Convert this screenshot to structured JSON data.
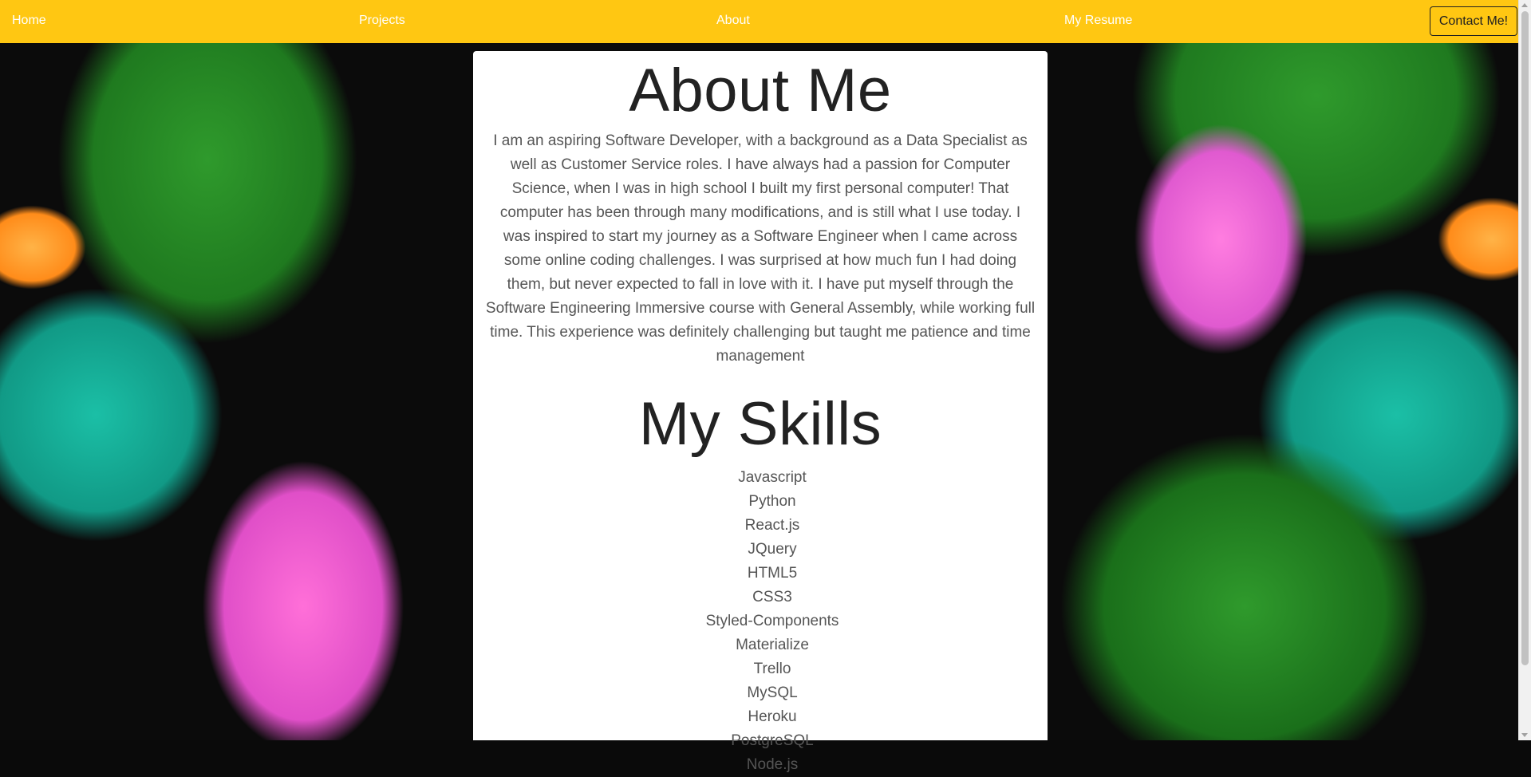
{
  "nav": {
    "home": "Home",
    "projects": "Projects",
    "about": "About",
    "resume": "My Resume",
    "contact": "Contact Me!"
  },
  "about": {
    "title": "About Me",
    "text": "I am an aspiring Software Developer, with a background as a Data Specialist as well as Customer Service roles. I have always had a passion for Computer Science, when I was in high school I built my first personal computer! That computer has been through many modifications, and is still what I use today. I was inspired to start my journey as a Software Engineer when I came across some online coding challenges. I was surprised at how much fun I had doing them, but never expected to fall in love with it. I have put myself through the Software Engineering Immersive course with General Assembly, while working full time. This experience was definitely challenging but taught me patience and time management"
  },
  "skills": {
    "title": "My Skills",
    "items": [
      "Javascript",
      "Python",
      "React.js",
      "JQuery",
      "HTML5",
      "CSS3",
      "Styled-Components",
      "Materialize",
      "Trello",
      "MySQL",
      "Heroku",
      "PostgreSQL",
      "Node.js"
    ]
  },
  "colors": {
    "navbar": "#ffc712",
    "card": "#ffffff",
    "text": "#555555"
  }
}
